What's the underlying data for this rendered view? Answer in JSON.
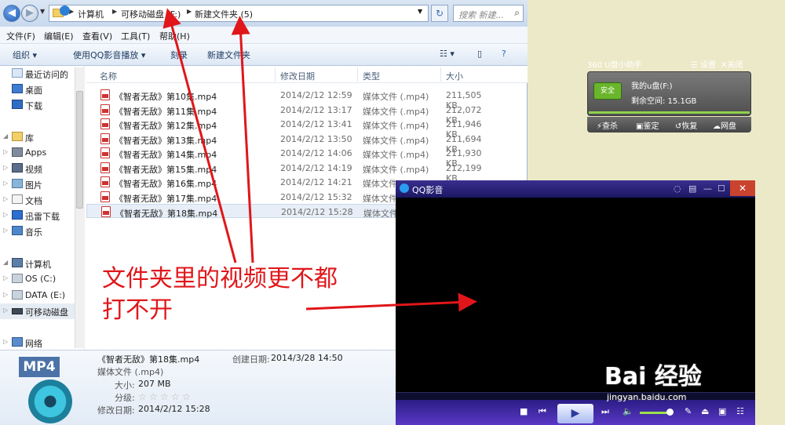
{
  "explorer": {
    "breadcrumb": [
      "计算机",
      "可移动磁盘 (F:)",
      "新建文件夹 (5)"
    ],
    "search_placeholder": "搜索 新建...",
    "menus": [
      "文件(F)",
      "编辑(E)",
      "查看(V)",
      "工具(T)",
      "帮助(H)"
    ],
    "toolbar": {
      "organize": "组织 ▾",
      "play_with": "使用QQ影音播放 ▾",
      "burn": "刻录",
      "new_folder": "新建文件夹"
    },
    "sidebar": [
      {
        "label": "最近访问的",
        "icon": "recent-icon"
      },
      {
        "label": "桌面",
        "icon": "desktop-icon"
      },
      {
        "label": "下载",
        "icon": "download-icon"
      },
      {
        "label": "库",
        "icon": "library-icon"
      },
      {
        "label": "Apps",
        "icon": "apps-icon"
      },
      {
        "label": "视频",
        "icon": "video-icon"
      },
      {
        "label": "图片",
        "icon": "picture-icon"
      },
      {
        "label": "文档",
        "icon": "document-icon"
      },
      {
        "label": "迅雷下载",
        "icon": "thunder-icon"
      },
      {
        "label": "音乐",
        "icon": "music-icon"
      },
      {
        "label": "计算机",
        "icon": "computer-icon"
      },
      {
        "label": "OS (C:)",
        "icon": "drive-icon"
      },
      {
        "label": "DATA (E:)",
        "icon": "drive-icon"
      },
      {
        "label": "可移动磁盘",
        "icon": "removable-drive-icon"
      },
      {
        "label": "网络",
        "icon": "network-icon"
      }
    ],
    "columns": [
      "名称",
      "修改日期",
      "类型",
      "大小"
    ],
    "files": [
      {
        "name": "《智者无敌》第10集.mp4",
        "date": "2014/2/12 12:59",
        "type": "媒体文件 (.mp4)",
        "size": "211,505 KB"
      },
      {
        "name": "《智者无敌》第11集.mp4",
        "date": "2014/2/12 13:17",
        "type": "媒体文件 (.mp4)",
        "size": "212,072 KB"
      },
      {
        "name": "《智者无敌》第12集.mp4",
        "date": "2014/2/12 13:41",
        "type": "媒体文件 (.mp4)",
        "size": "211,946 KB"
      },
      {
        "name": "《智者无敌》第13集.mp4",
        "date": "2014/2/12 13:50",
        "type": "媒体文件 (.mp4)",
        "size": "211,694 KB"
      },
      {
        "name": "《智者无敌》第14集.mp4",
        "date": "2014/2/12 14:06",
        "type": "媒体文件 (.mp4)",
        "size": "211,930 KB"
      },
      {
        "name": "《智者无敌》第15集.mp4",
        "date": "2014/2/12 14:19",
        "type": "媒体文件 (.mp4)",
        "size": "212,199 KB"
      },
      {
        "name": "《智者无敌》第16集.mp4",
        "date": "2014/2/12 14:21",
        "type": "媒体文件 (.mp4)",
        "size": ""
      },
      {
        "name": "《智者无敌》第17集.mp4",
        "date": "2014/2/12 15:32",
        "type": "媒体文件 (.mp4)",
        "size": ""
      },
      {
        "name": "《智者无敌》第18集.mp4",
        "date": "2014/2/12 15:28",
        "type": "媒体文件 (.mp4)",
        "size": ""
      }
    ],
    "details": {
      "badge": "MP4",
      "filename": "《智者无敌》第18集.mp4",
      "created_label": "创建日期:",
      "created": "2014/3/28 14:50",
      "type": "媒体文件 (.mp4)",
      "size_label": "大小:",
      "size": "207 MB",
      "rating_label": "分级:",
      "modified_label": "修改日期:",
      "modified": "2014/2/12 15:28"
    }
  },
  "usb_helper": {
    "title": "360 U盘小助手",
    "settings": "设置",
    "close": "关闭",
    "badge": "安全",
    "disk_name": "我的u盘(F:)",
    "free_space": "剩余空间: 15.1GB",
    "buttons": [
      "查杀",
      "鉴定",
      "恢复",
      "网盘"
    ]
  },
  "player": {
    "title": "QQ影音"
  },
  "annotation": {
    "line1": "文件夹里的视频更不都",
    "line2": "打不开"
  },
  "watermark": {
    "brand": "Bai 经验",
    "url": "jingyan.baidu.com"
  }
}
